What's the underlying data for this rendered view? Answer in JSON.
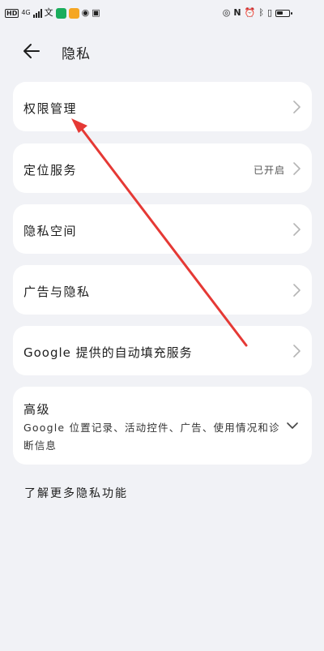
{
  "status_bar": {
    "hd_label": "HD",
    "network_label": "4G",
    "app_icons": [
      {
        "name": "message-app-icon",
        "color": "#1aad5c"
      },
      {
        "name": "orange-app-icon",
        "color": "#f5a623"
      }
    ],
    "battery_level": 0.55,
    "right_icons": [
      "eye-icon",
      "nfc-icon",
      "alarm-icon",
      "bluetooth-icon",
      "vibrate-icon",
      "battery-icon"
    ]
  },
  "header": {
    "title": "隐私",
    "back_icon": "back-arrow-icon"
  },
  "menu": {
    "permissions": {
      "label": "权限管理"
    },
    "location": {
      "label": "定位服务",
      "value": "已开启"
    },
    "private_space": {
      "label": "隐私空间"
    },
    "ads": {
      "label": "广告与隐私"
    },
    "autofill": {
      "label": "Google 提供的自动填充服务"
    },
    "advanced": {
      "title": "高级",
      "desc": "Google 位置记录、活动控件、广告、使用情况和诊断信息"
    }
  },
  "link": {
    "label": "了解更多隐私功能"
  },
  "colors": {
    "background": "#f1f2f6",
    "card": "#ffffff",
    "annotation": "#e53935",
    "chevron": "#b5b5b5"
  }
}
